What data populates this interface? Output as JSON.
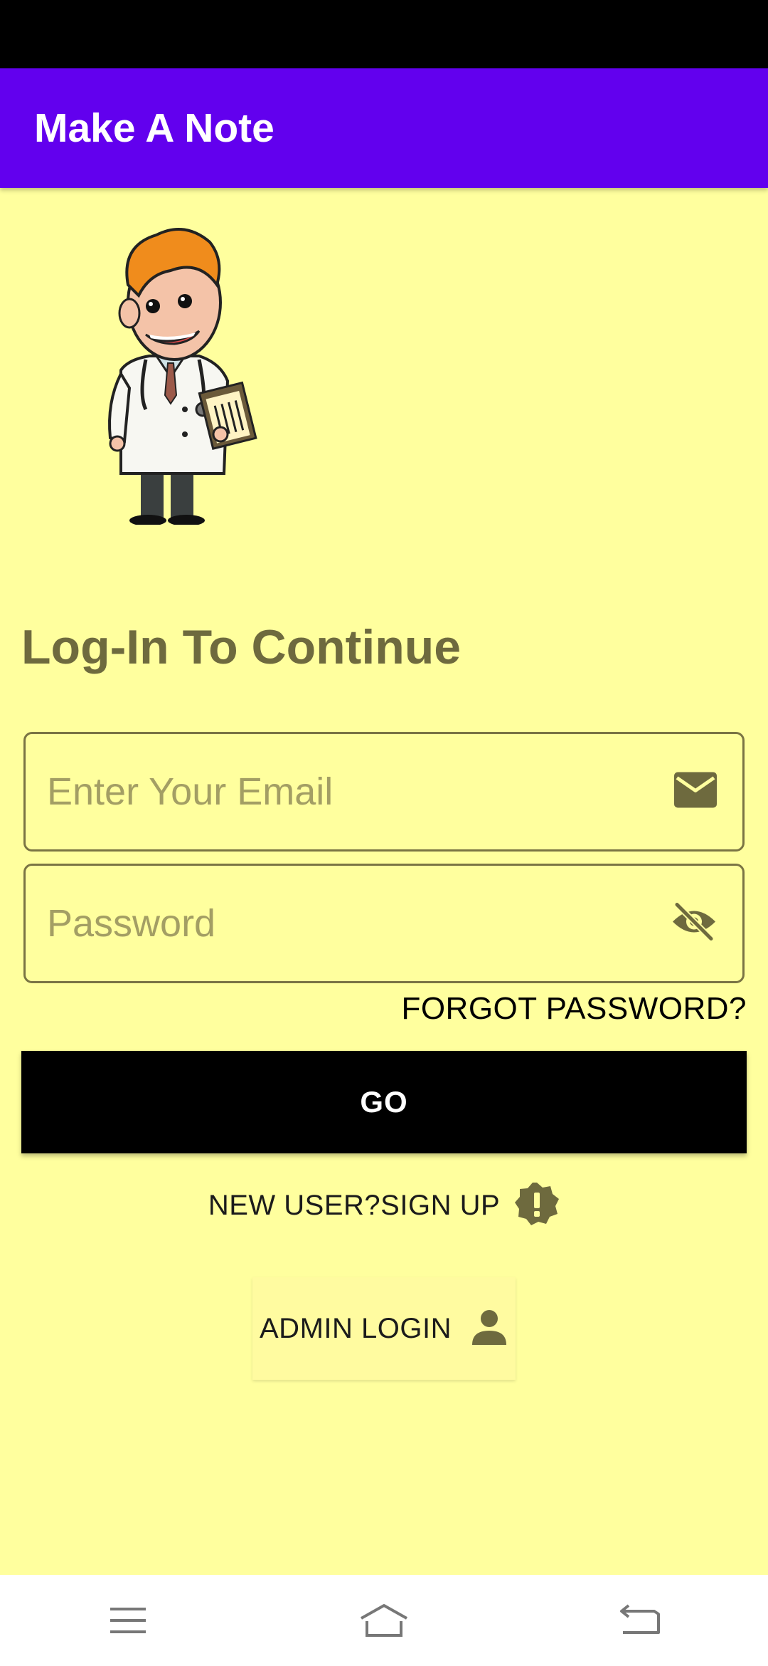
{
  "app": {
    "title": "Make A Note"
  },
  "login": {
    "heading": "Log-In To Continue",
    "email_placeholder": "Enter Your Email",
    "password_placeholder": "Password",
    "forgot_label": "FORGOT PASSWORD?",
    "go_label": "GO",
    "signup_label": "NEW USER?SIGN UP",
    "admin_label": "ADMIN LOGIN"
  },
  "icons": {
    "email": "mail-icon",
    "password": "visibility-off-icon",
    "signup": "alert-badge-icon",
    "admin": "person-icon",
    "nav": [
      "menu-icon",
      "home-icon",
      "back-icon"
    ]
  },
  "colors": {
    "app_bar": "#6200ee",
    "background": "#ffff9e",
    "accent_text": "#6e6a3e",
    "button": "#000000"
  }
}
